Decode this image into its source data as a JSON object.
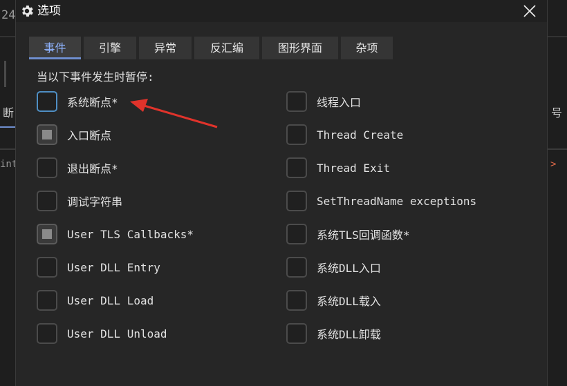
{
  "background": {
    "left_fragments": [
      "24",
      "断",
      "int"
    ],
    "right_fragments": [
      "号",
      ">"
    ]
  },
  "dialog": {
    "title": "选项",
    "title_icon": "gear-icon",
    "close_icon": "close-icon"
  },
  "tabs": [
    {
      "label": "事件",
      "active": true
    },
    {
      "label": "引擎",
      "active": false
    },
    {
      "label": "异常",
      "active": false
    },
    {
      "label": "反汇编",
      "active": false
    },
    {
      "label": "图形界面",
      "active": false
    },
    {
      "label": "杂项",
      "active": false
    }
  ],
  "prompt": "当以下事件发生时暂停:",
  "left_options": [
    {
      "label": "系统断点*",
      "state": "unchecked",
      "focused": true
    },
    {
      "label": "入口断点",
      "state": "indeterminate"
    },
    {
      "label": "退出断点*",
      "state": "unchecked"
    },
    {
      "label": "调试字符串",
      "state": "unchecked"
    },
    {
      "label": "User TLS Callbacks*",
      "state": "indeterminate"
    },
    {
      "label": "User DLL Entry",
      "state": "unchecked"
    },
    {
      "label": "User DLL Load",
      "state": "unchecked"
    },
    {
      "label": "User DLL Unload",
      "state": "unchecked"
    }
  ],
  "right_options": [
    {
      "label": "线程入口",
      "state": "unchecked"
    },
    {
      "label": "Thread Create",
      "state": "unchecked"
    },
    {
      "label": "Thread Exit",
      "state": "unchecked"
    },
    {
      "label": "SetThreadName exceptions",
      "state": "unchecked"
    },
    {
      "label": "系统TLS回调函数*",
      "state": "unchecked"
    },
    {
      "label": "系统DLL入口",
      "state": "unchecked"
    },
    {
      "label": "系统DLL载入",
      "state": "unchecked"
    },
    {
      "label": "系统DLL卸载",
      "state": "unchecked"
    }
  ],
  "colors": {
    "accent": "#6f8fd0",
    "annotation_arrow": "#e0332b"
  }
}
